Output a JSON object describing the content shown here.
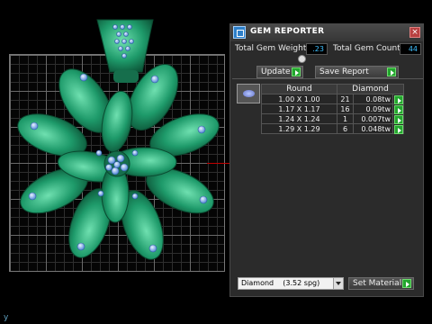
{
  "window": {
    "title": "GEM REPORTER",
    "close": "×"
  },
  "summary": {
    "total_weight_label": "Total Gem Weight",
    "total_weight_value": ".23",
    "total_count_label": "Total Gem Count",
    "total_count_value": "44"
  },
  "toolbar": {
    "update_label": "Update",
    "save_label": "Save Report"
  },
  "table": {
    "shape_header": "Round",
    "material_header": "Diamond",
    "rows": [
      {
        "size": "1.00 X 1.00",
        "count": "21",
        "weight": "0.08tw"
      },
      {
        "size": "1.17 X 1.17",
        "count": "16",
        "weight": "0.09tw"
      },
      {
        "size": "1.24 X 1.24",
        "count": "1",
        "weight": "0.007tw"
      },
      {
        "size": "1.29 X 1.29",
        "count": "6",
        "weight": "0.048tw"
      }
    ]
  },
  "material": {
    "selected": "Diamond    (3.52 spg)",
    "set_label": "Set Material"
  },
  "viewport": {
    "axis_label": "y"
  },
  "colors": {
    "gem_metal": "#1e9a6a",
    "gem_stone": "#7fb8ff",
    "accent_go": "#23a62e",
    "value_text": "#3ec0ff"
  }
}
